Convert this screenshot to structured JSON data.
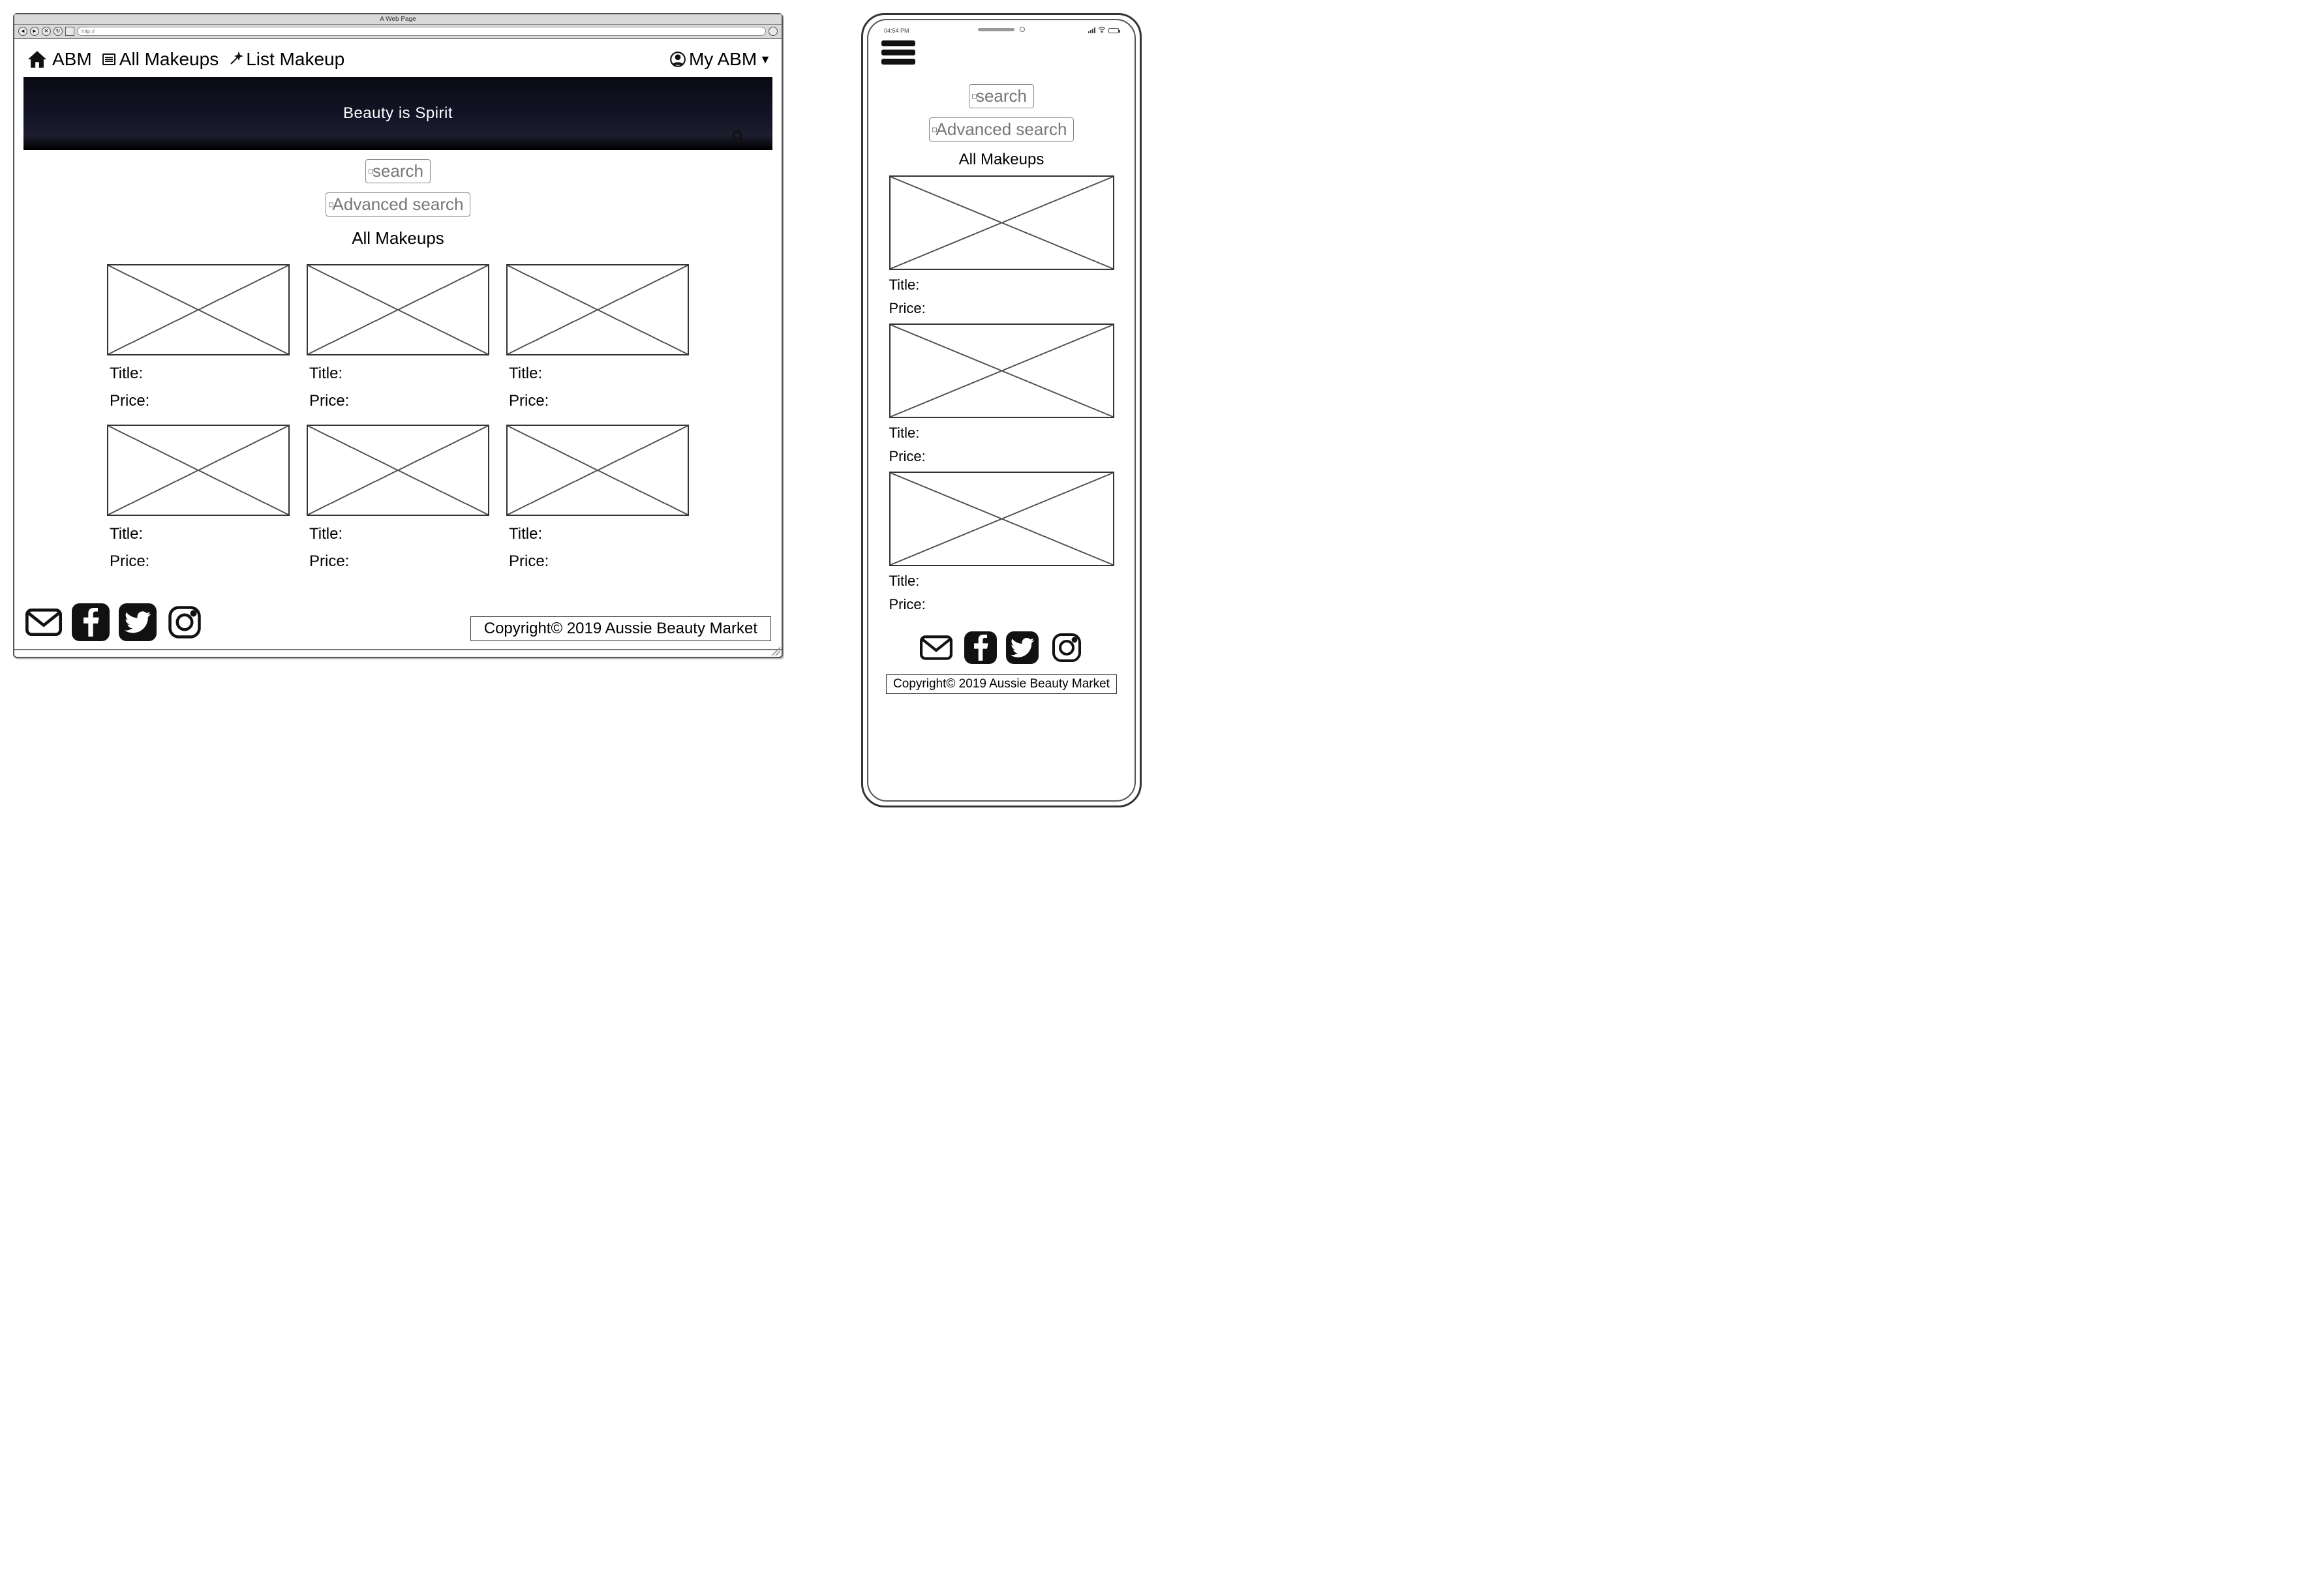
{
  "browser": {
    "title_label": "A Web Page",
    "address": "http://"
  },
  "nav": {
    "brand": "ABM",
    "all_makeups": "All Makeups",
    "list_makeup": "List Makeup",
    "my_abm": "My ABM"
  },
  "hero": {
    "tagline": "Beauty is Spirit"
  },
  "search": {
    "basic_label": "search",
    "advanced_label": "Advanced search"
  },
  "section": {
    "all_makeups_title": "All Makeups"
  },
  "card_labels": {
    "title": "Title:",
    "price": "Price:"
  },
  "desktop_grid": [
    {
      "title": "Title:",
      "price": "Price:"
    },
    {
      "title": "Title:",
      "price": "Price:"
    },
    {
      "title": "Title:",
      "price": "Price:"
    },
    {
      "title": "Title:",
      "price": "Price:"
    },
    {
      "title": "Title:",
      "price": "Price:"
    },
    {
      "title": "Title:",
      "price": "Price:"
    }
  ],
  "mobile_grid": [
    {
      "title": "Title:",
      "price": "Price:"
    },
    {
      "title": "Title:",
      "price": "Price:"
    },
    {
      "title": "Title:",
      "price": "Price:"
    }
  ],
  "footer": {
    "copyright": "Copyright© 2019 Aussie Beauty Market"
  },
  "phone": {
    "time": "04:54 PM"
  }
}
